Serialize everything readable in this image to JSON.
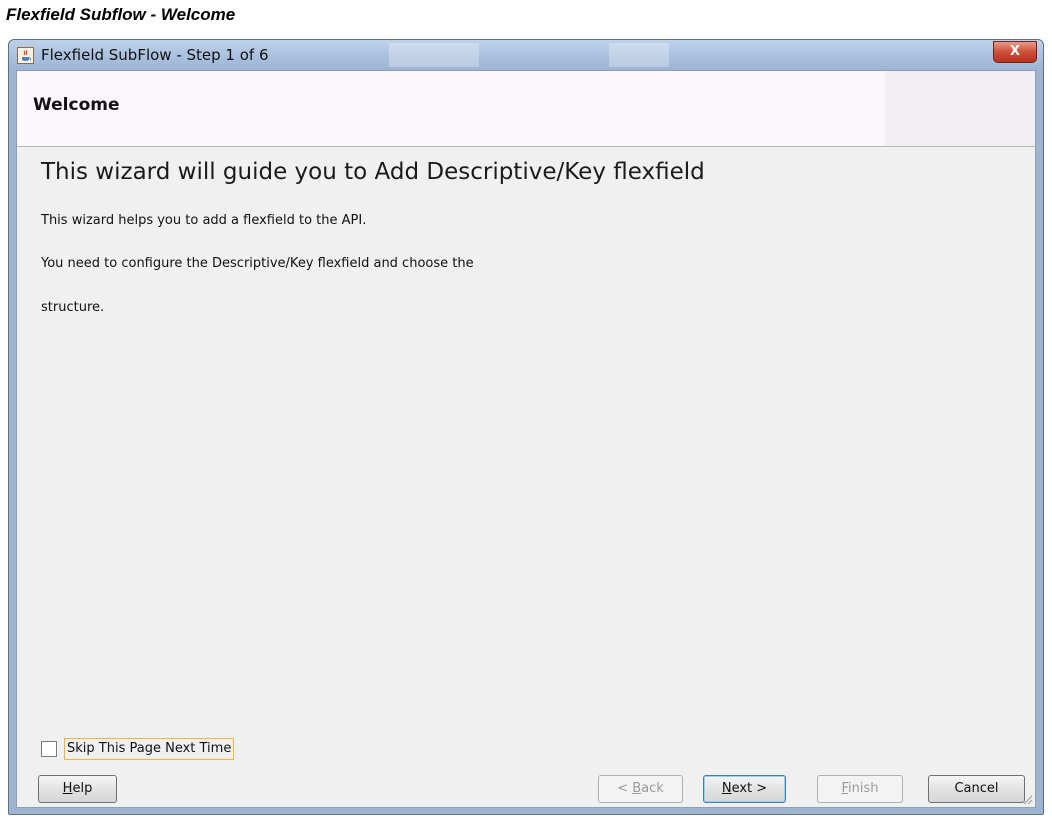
{
  "caption": "Flexfield Subflow - Welcome",
  "window": {
    "title": "Flexfield SubFlow - Step 1 of 6",
    "close_glyph": "X",
    "icon": "java-cup-icon"
  },
  "header": {
    "title": "Welcome"
  },
  "content": {
    "heading": "This wizard will guide you to Add Descriptive/Key flexfield",
    "paragraphs": [
      "This wizard helps you to add a flexfield to the API.",
      "You need to configure the Descriptive/Key flexfield and choose the",
      "structure."
    ]
  },
  "skip_checkbox": {
    "label_mnemonic": "S",
    "label_rest": "kip This Page Next Time",
    "checked": false
  },
  "buttons": {
    "help": {
      "mnemonic": "H",
      "rest": "elp"
    },
    "back": {
      "prefix": "< ",
      "mnemonic": "B",
      "rest": "ack"
    },
    "next": {
      "mnemonic": "N",
      "rest": "ext >"
    },
    "finish": {
      "mnemonic": "F",
      "rest": "inish"
    },
    "cancel": {
      "label": "Cancel"
    }
  }
}
